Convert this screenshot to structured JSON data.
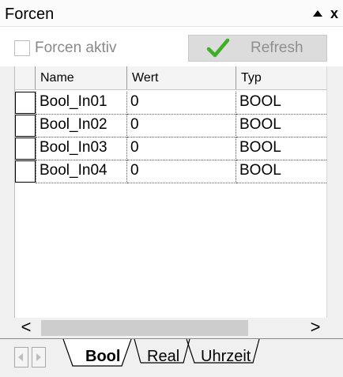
{
  "window": {
    "title": "Forcen",
    "pin_icon": "pin-up-icon",
    "close_symbol": "x"
  },
  "toolbar": {
    "force_active_label": "Forcen aktiv",
    "force_active_checked": false,
    "refresh_label": "Refresh",
    "refresh_icon": "green-checkmark-icon"
  },
  "grid": {
    "columns": [
      "Name",
      "Wert",
      "Typ"
    ],
    "rows": [
      {
        "name": "Bool_In01",
        "wert": "0",
        "typ": "BOOL",
        "checked": false
      },
      {
        "name": "Bool_In02",
        "wert": "0",
        "typ": "BOOL",
        "checked": false
      },
      {
        "name": "Bool_In03",
        "wert": "0",
        "typ": "BOOL",
        "checked": false
      },
      {
        "name": "Bool_In04",
        "wert": "0",
        "typ": "BOOL",
        "checked": false
      }
    ]
  },
  "scrollbar": {
    "left_arrow": "<",
    "right_arrow": ">"
  },
  "tabs": {
    "items": [
      "Bool",
      "Real",
      "Uhrzeit"
    ],
    "active": "Bool"
  },
  "colors": {
    "check_green": "#3fae29",
    "panel_bg": "#f0f0f0"
  }
}
